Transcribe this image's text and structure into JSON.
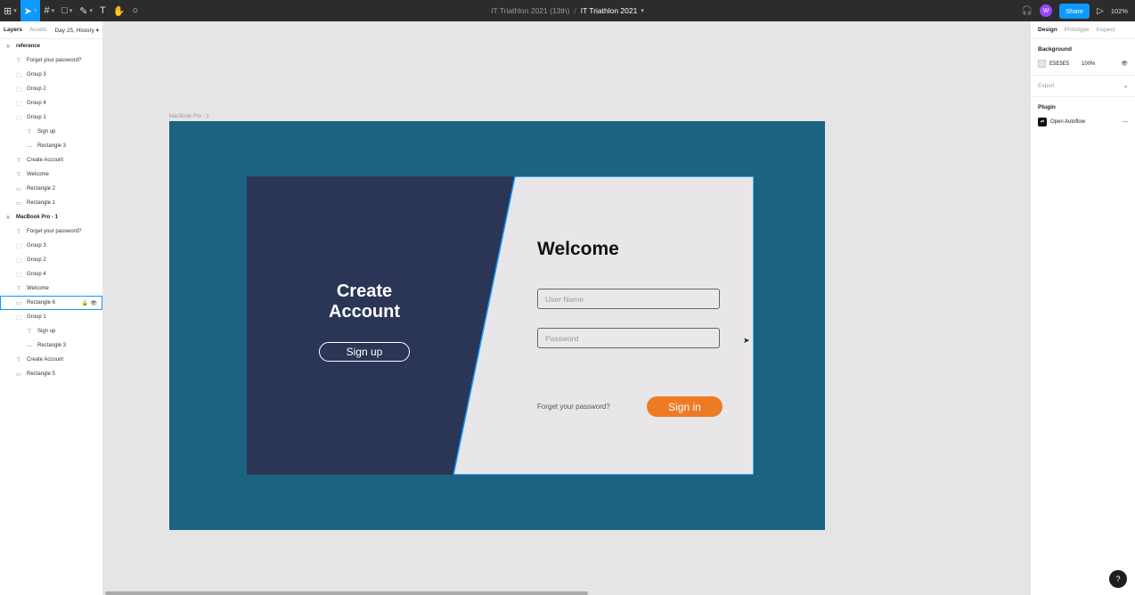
{
  "toolbar": {
    "project": "IT Triathlon 2021 (13th)",
    "separator": "/",
    "file_name": "IT Triathlon 2021",
    "share_label": "Share",
    "avatar_initial": "W",
    "zoom": "102%"
  },
  "left_panel": {
    "tabs": [
      "Layers",
      "Assets"
    ],
    "page_selector": "Day 25, History",
    "layers": [
      {
        "label": "reference",
        "kind": "frame",
        "indent": 0
      },
      {
        "label": "Forget your password?",
        "kind": "text",
        "indent": 1
      },
      {
        "label": "Group 3",
        "kind": "group",
        "indent": 1
      },
      {
        "label": "Group 2",
        "kind": "group",
        "indent": 1
      },
      {
        "label": "Group 4",
        "kind": "group",
        "indent": 1
      },
      {
        "label": "Group 1",
        "kind": "group",
        "indent": 1
      },
      {
        "label": "Sign up",
        "kind": "text",
        "indent": 2
      },
      {
        "label": "Rectangle 3",
        "kind": "line",
        "indent": 2
      },
      {
        "label": "Create Account",
        "kind": "text",
        "indent": 1
      },
      {
        "label": "Welcome",
        "kind": "text",
        "indent": 1
      },
      {
        "label": "Rectangle 2",
        "kind": "rect",
        "indent": 1
      },
      {
        "label": "Rectangle 1",
        "kind": "rect",
        "indent": 1
      },
      {
        "label": "MacBook Pro - 1",
        "kind": "frame",
        "indent": 0
      },
      {
        "label": "Forget your password?",
        "kind": "text",
        "indent": 1
      },
      {
        "label": "Group 3",
        "kind": "group",
        "indent": 1
      },
      {
        "label": "Group 2",
        "kind": "group",
        "indent": 1
      },
      {
        "label": "Group 4",
        "kind": "group",
        "indent": 1
      },
      {
        "label": "Welcome",
        "kind": "text",
        "indent": 1
      },
      {
        "label": "Rectangle 6",
        "kind": "rect",
        "indent": 1,
        "selected": true
      },
      {
        "label": "Group 1",
        "kind": "group",
        "indent": 1
      },
      {
        "label": "Sign up",
        "kind": "text",
        "indent": 2
      },
      {
        "label": "Rectangle 3",
        "kind": "line",
        "indent": 2
      },
      {
        "label": "Create Account",
        "kind": "text",
        "indent": 1
      },
      {
        "label": "Rectangle 5",
        "kind": "rect",
        "indent": 1
      }
    ]
  },
  "right_panel": {
    "tabs": [
      "Design",
      "Prototype",
      "Inspect"
    ],
    "background_label": "Background",
    "background_hex": "E5E5E5",
    "background_opacity": "100%",
    "export_label": "Export",
    "plugin_label": "Plugin",
    "plugin_name": "Open Autoflow"
  },
  "canvas": {
    "frame_label": "MacBook Pro - 1",
    "create_account": "Create Account",
    "sign_up": "Sign up",
    "welcome": "Welcome",
    "username_placeholder": "User Name",
    "password_placeholder": "Password",
    "forgot": "Forget your password?",
    "sign_in": "Sign in"
  },
  "colors": {
    "artboard": "#1b6381",
    "dark_panel": "#2b3556",
    "card_light": "#e8e6e9",
    "accent": "#ee7b24",
    "selection": "#0d99ff"
  },
  "help_label": "?"
}
